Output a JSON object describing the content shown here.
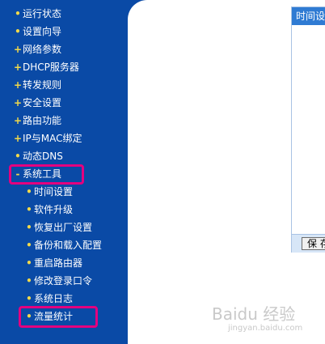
{
  "sidebar": {
    "items": [
      {
        "mark": "•",
        "label": "运行状态"
      },
      {
        "mark": "•",
        "label": "设置向导"
      },
      {
        "mark": "+",
        "label": "网络参数"
      },
      {
        "mark": "+",
        "label": "DHCP服务器"
      },
      {
        "mark": "+",
        "label": "转发规则"
      },
      {
        "mark": "+",
        "label": "安全设置"
      },
      {
        "mark": "+",
        "label": "路由功能"
      },
      {
        "mark": "+",
        "label": "IP与MAC绑定"
      },
      {
        "mark": "•",
        "label": "动态DNS"
      },
      {
        "mark": "-",
        "label": "系统工具"
      }
    ],
    "subitems": [
      {
        "mark": "•",
        "label": "时间设置"
      },
      {
        "mark": "•",
        "label": "软件升级"
      },
      {
        "mark": "•",
        "label": "恢复出厂设置"
      },
      {
        "mark": "•",
        "label": "备份和载入配置"
      },
      {
        "mark": "•",
        "label": "重启路由器"
      },
      {
        "mark": "•",
        "label": "修改登录口令"
      },
      {
        "mark": "•",
        "label": "系统日志"
      },
      {
        "mark": "•",
        "label": "流量统计"
      }
    ]
  },
  "panel": {
    "title": "时间设置",
    "save_label": "保 存"
  },
  "watermark": {
    "text": "Baidu 经验",
    "url": "jingyan.baidu.com"
  },
  "colors": {
    "sidebar_bg": "#0a4aa6",
    "highlight": "#e3007f",
    "panel_title_bg": "#2f7bd3"
  }
}
